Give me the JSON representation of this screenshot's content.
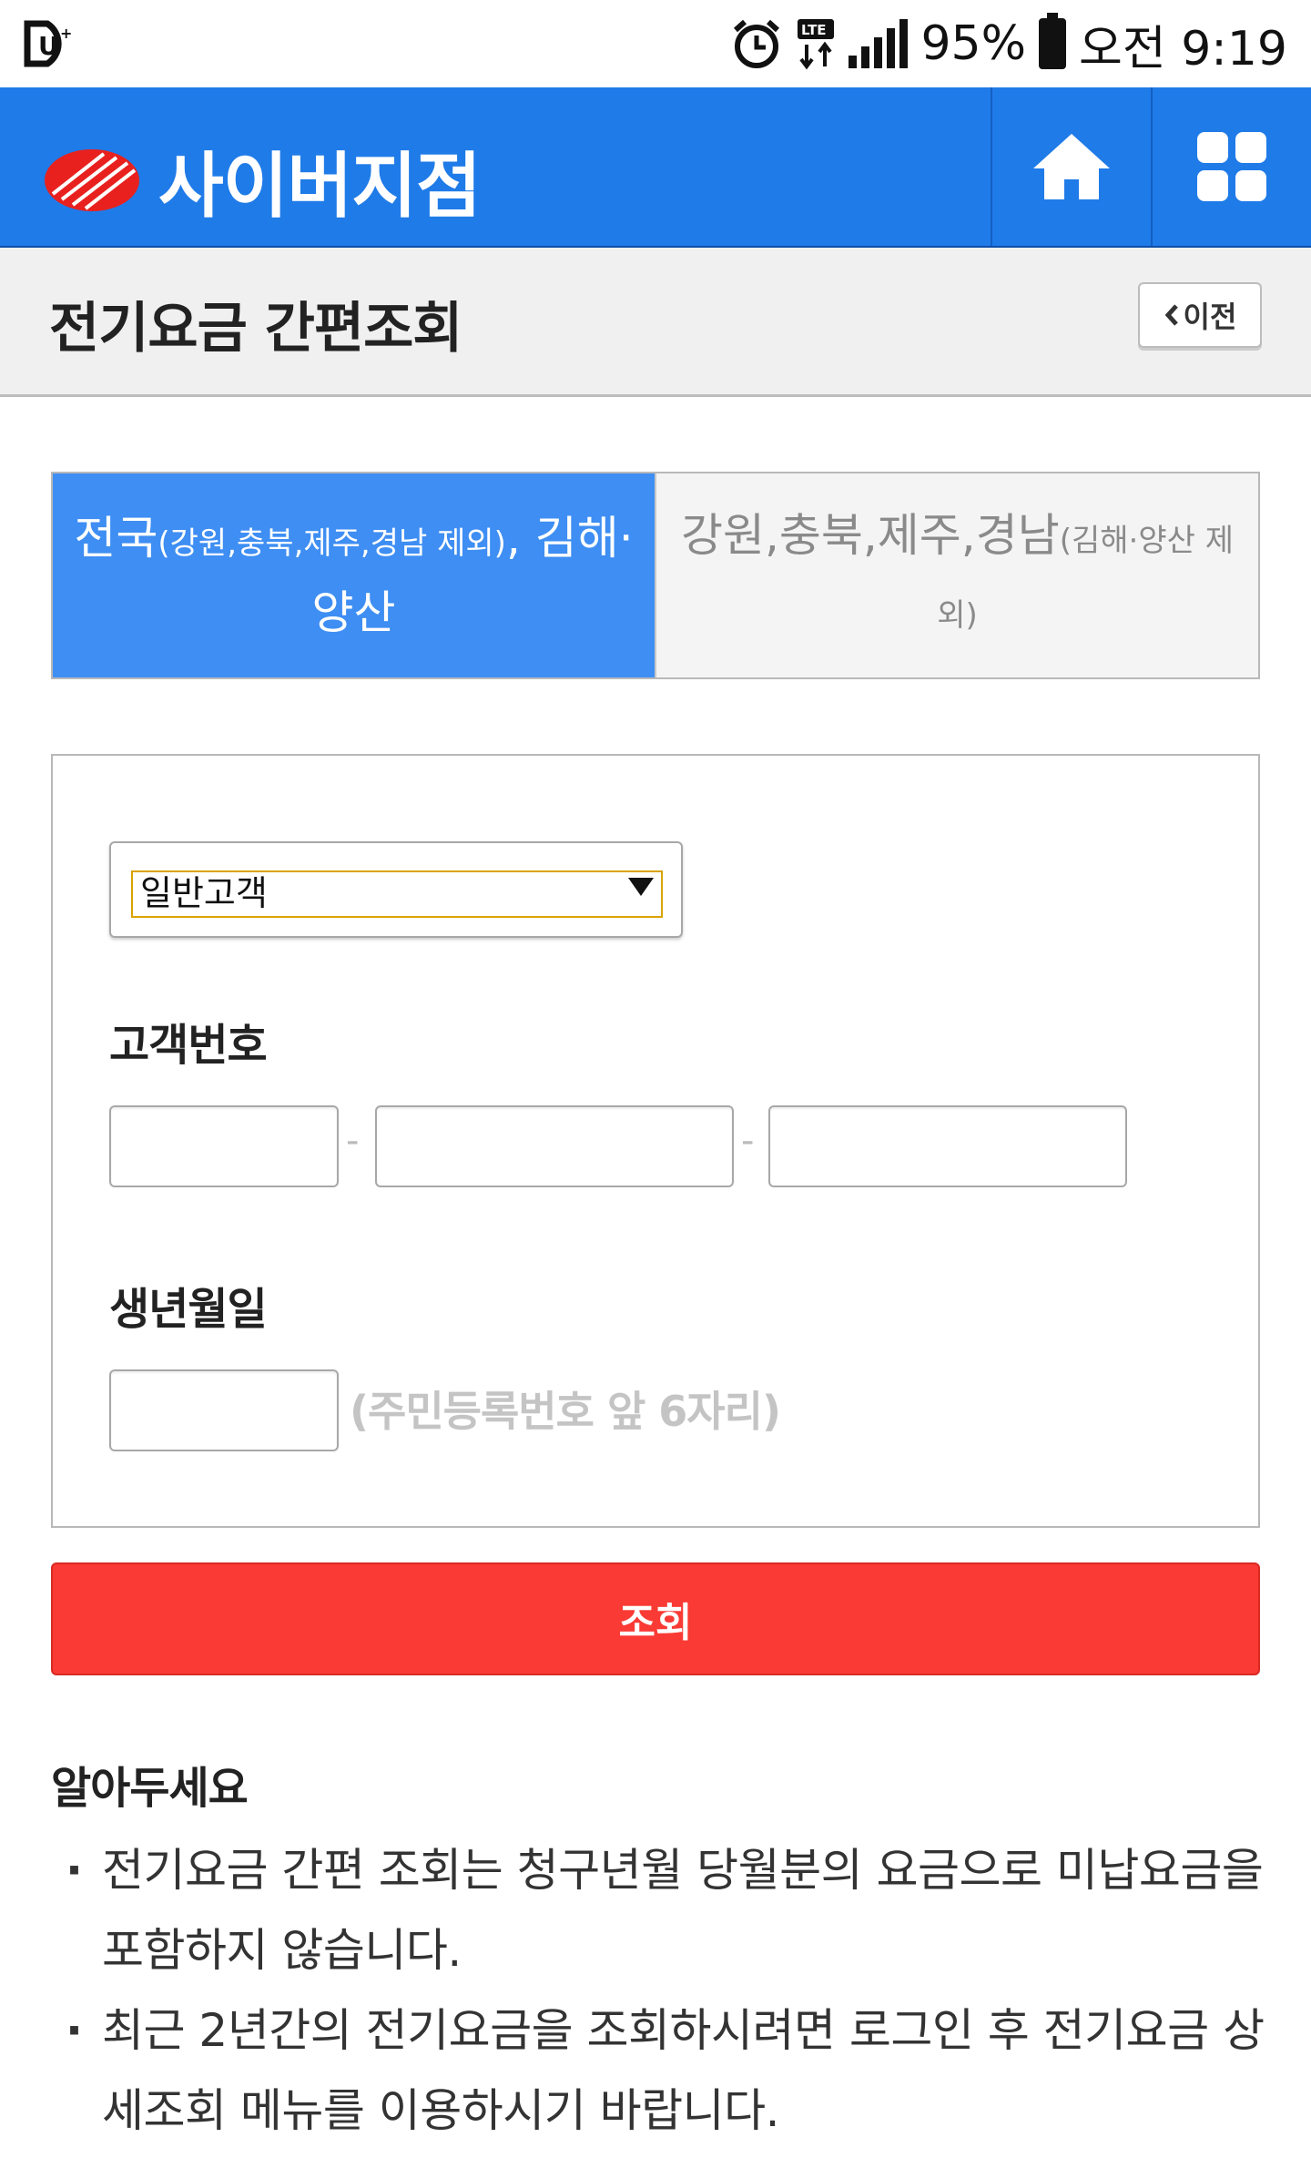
{
  "status_bar": {
    "battery": "95%",
    "time": "오전 9:19",
    "network": "LTE"
  },
  "header": {
    "brand": "사이버지점",
    "icons": [
      "home-icon",
      "grid-menu-icon"
    ],
    "accent_color": "#1f7be8"
  },
  "page": {
    "title": "전기요금 간편조회",
    "back_label": "이전"
  },
  "tabs": [
    {
      "label_main": "전국",
      "label_small": "(강원,충북,제주,경남 제외)",
      "label_rest": ", 김해·양산",
      "active": true
    },
    {
      "label_main": "강원,충북,제주,경남",
      "label_small": "(김해·양산 제외)",
      "label_rest": "",
      "active": false
    }
  ],
  "form": {
    "customer_type": "일반고객",
    "customer_no_label": "고객번호",
    "separator": "-",
    "birth_label": "생년월일",
    "birth_hint": "(주민등록번호 앞 6자리)",
    "submit_label": "조회",
    "submit_color": "#fa3a34"
  },
  "notice": {
    "title": "알아두세요",
    "items": [
      "전기요금 간편 조회는 청구년월 당월분의 요금으로 미납요금을 포함하지 않습니다.",
      "최근 2년간의 전기요금을 조회하시려면 로그인 후 전기요금 상세조회 메뉴를 이용하시기 바랍니다."
    ]
  }
}
